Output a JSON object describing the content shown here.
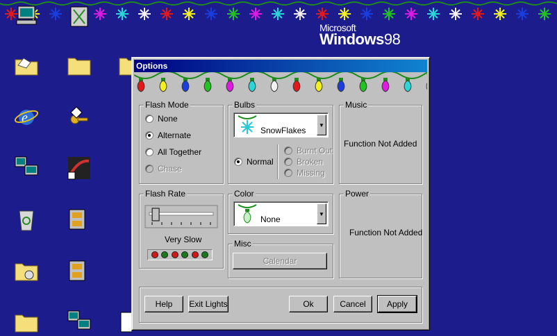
{
  "desktop": {
    "brand_ms": "Microsoft",
    "brand_windows": "Windows",
    "brand_version": "98"
  },
  "dialog": {
    "title": "Options",
    "flash_mode": {
      "label": "Flash Mode",
      "options": [
        "None",
        "Alternate",
        "All Together",
        "Chase"
      ],
      "selected": "Alternate"
    },
    "bulbs": {
      "label": "Bulbs",
      "selected": "SnowFlakes",
      "normal_label": "Normal",
      "states": [
        "Burnt Out",
        "Broken",
        "Missing"
      ]
    },
    "music": {
      "label": "Music",
      "status": "Function Not Added"
    },
    "flash_rate": {
      "label": "Flash Rate",
      "value_label": "Very Slow",
      "slider_fraction": 0.05
    },
    "color": {
      "label": "Color",
      "selected": "None"
    },
    "misc": {
      "label": "Misc",
      "calendar_label": "Calendar"
    },
    "power": {
      "label": "Power",
      "status": "Function Not Added"
    },
    "buttons": {
      "help": "Help",
      "exit": "Exit Lights",
      "ok": "Ok",
      "cancel": "Cancel",
      "apply": "Apply"
    }
  },
  "colors": {
    "desktop": "#1c1c8c",
    "titlebar": "#000080",
    "bulbs": [
      "#e31919",
      "#f2f21a",
      "#1a3ee0",
      "#21c421",
      "#e01ae0",
      "#28d8d8",
      "#f2f2f2"
    ]
  }
}
